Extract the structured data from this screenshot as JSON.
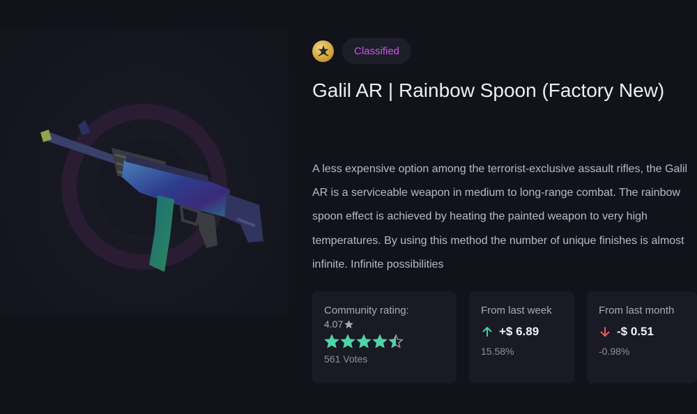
{
  "item": {
    "rarity": "Classified",
    "rank_icon": "rank-emblem-icon",
    "title": "Galil AR | Rainbow Spoon (Factory New)",
    "description": "A less expensive option among the terrorist-exclusive assault rifles, the Galil AR is a serviceable weapon in medium to long-range combat. The rainbow spoon effect is achieved by heating the painted weapon to very high temperatures. By using this method the number of unique finishes is almost infinite. Infinite possibilities",
    "image_icon": "galil-ar-rifle-image"
  },
  "rating": {
    "label": "Community rating:",
    "value": "4.07",
    "stars_value": 4.07,
    "stars_max": 5,
    "votes": "561 Votes"
  },
  "week": {
    "label": "From last week",
    "direction": "up",
    "value": "+$ 6.89",
    "percent": "15.58%"
  },
  "month": {
    "label": "From last month",
    "direction": "down",
    "value": "-$ 0.51",
    "percent": "-0.98%"
  },
  "colors": {
    "background": "#11121a",
    "rarity": "#c55be0",
    "star": "#4fd4a6",
    "up_arrow": "#3fd6a4",
    "down_arrow": "#ef5a5a"
  }
}
